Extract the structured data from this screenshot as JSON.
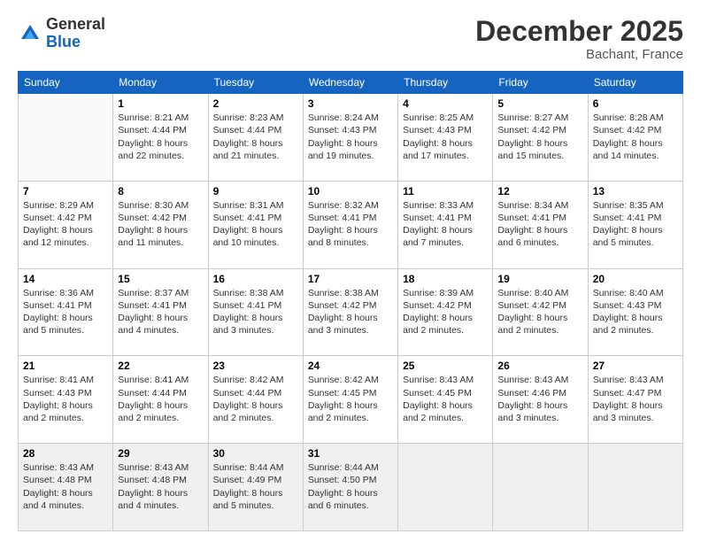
{
  "logo": {
    "general": "General",
    "blue": "Blue"
  },
  "header": {
    "month": "December 2025",
    "location": "Bachant, France"
  },
  "weekdays": [
    "Sunday",
    "Monday",
    "Tuesday",
    "Wednesday",
    "Thursday",
    "Friday",
    "Saturday"
  ],
  "weeks": [
    [
      {
        "day": "",
        "sunrise": "",
        "sunset": "",
        "daylight": ""
      },
      {
        "day": "1",
        "sunrise": "Sunrise: 8:21 AM",
        "sunset": "Sunset: 4:44 PM",
        "daylight": "Daylight: 8 hours and 22 minutes."
      },
      {
        "day": "2",
        "sunrise": "Sunrise: 8:23 AM",
        "sunset": "Sunset: 4:44 PM",
        "daylight": "Daylight: 8 hours and 21 minutes."
      },
      {
        "day": "3",
        "sunrise": "Sunrise: 8:24 AM",
        "sunset": "Sunset: 4:43 PM",
        "daylight": "Daylight: 8 hours and 19 minutes."
      },
      {
        "day": "4",
        "sunrise": "Sunrise: 8:25 AM",
        "sunset": "Sunset: 4:43 PM",
        "daylight": "Daylight: 8 hours and 17 minutes."
      },
      {
        "day": "5",
        "sunrise": "Sunrise: 8:27 AM",
        "sunset": "Sunset: 4:42 PM",
        "daylight": "Daylight: 8 hours and 15 minutes."
      },
      {
        "day": "6",
        "sunrise": "Sunrise: 8:28 AM",
        "sunset": "Sunset: 4:42 PM",
        "daylight": "Daylight: 8 hours and 14 minutes."
      }
    ],
    [
      {
        "day": "7",
        "sunrise": "Sunrise: 8:29 AM",
        "sunset": "Sunset: 4:42 PM",
        "daylight": "Daylight: 8 hours and 12 minutes."
      },
      {
        "day": "8",
        "sunrise": "Sunrise: 8:30 AM",
        "sunset": "Sunset: 4:42 PM",
        "daylight": "Daylight: 8 hours and 11 minutes."
      },
      {
        "day": "9",
        "sunrise": "Sunrise: 8:31 AM",
        "sunset": "Sunset: 4:41 PM",
        "daylight": "Daylight: 8 hours and 10 minutes."
      },
      {
        "day": "10",
        "sunrise": "Sunrise: 8:32 AM",
        "sunset": "Sunset: 4:41 PM",
        "daylight": "Daylight: 8 hours and 8 minutes."
      },
      {
        "day": "11",
        "sunrise": "Sunrise: 8:33 AM",
        "sunset": "Sunset: 4:41 PM",
        "daylight": "Daylight: 8 hours and 7 minutes."
      },
      {
        "day": "12",
        "sunrise": "Sunrise: 8:34 AM",
        "sunset": "Sunset: 4:41 PM",
        "daylight": "Daylight: 8 hours and 6 minutes."
      },
      {
        "day": "13",
        "sunrise": "Sunrise: 8:35 AM",
        "sunset": "Sunset: 4:41 PM",
        "daylight": "Daylight: 8 hours and 5 minutes."
      }
    ],
    [
      {
        "day": "14",
        "sunrise": "Sunrise: 8:36 AM",
        "sunset": "Sunset: 4:41 PM",
        "daylight": "Daylight: 8 hours and 5 minutes."
      },
      {
        "day": "15",
        "sunrise": "Sunrise: 8:37 AM",
        "sunset": "Sunset: 4:41 PM",
        "daylight": "Daylight: 8 hours and 4 minutes."
      },
      {
        "day": "16",
        "sunrise": "Sunrise: 8:38 AM",
        "sunset": "Sunset: 4:41 PM",
        "daylight": "Daylight: 8 hours and 3 minutes."
      },
      {
        "day": "17",
        "sunrise": "Sunrise: 8:38 AM",
        "sunset": "Sunset: 4:42 PM",
        "daylight": "Daylight: 8 hours and 3 minutes."
      },
      {
        "day": "18",
        "sunrise": "Sunrise: 8:39 AM",
        "sunset": "Sunset: 4:42 PM",
        "daylight": "Daylight: 8 hours and 2 minutes."
      },
      {
        "day": "19",
        "sunrise": "Sunrise: 8:40 AM",
        "sunset": "Sunset: 4:42 PM",
        "daylight": "Daylight: 8 hours and 2 minutes."
      },
      {
        "day": "20",
        "sunrise": "Sunrise: 8:40 AM",
        "sunset": "Sunset: 4:43 PM",
        "daylight": "Daylight: 8 hours and 2 minutes."
      }
    ],
    [
      {
        "day": "21",
        "sunrise": "Sunrise: 8:41 AM",
        "sunset": "Sunset: 4:43 PM",
        "daylight": "Daylight: 8 hours and 2 minutes."
      },
      {
        "day": "22",
        "sunrise": "Sunrise: 8:41 AM",
        "sunset": "Sunset: 4:44 PM",
        "daylight": "Daylight: 8 hours and 2 minutes."
      },
      {
        "day": "23",
        "sunrise": "Sunrise: 8:42 AM",
        "sunset": "Sunset: 4:44 PM",
        "daylight": "Daylight: 8 hours and 2 minutes."
      },
      {
        "day": "24",
        "sunrise": "Sunrise: 8:42 AM",
        "sunset": "Sunset: 4:45 PM",
        "daylight": "Daylight: 8 hours and 2 minutes."
      },
      {
        "day": "25",
        "sunrise": "Sunrise: 8:43 AM",
        "sunset": "Sunset: 4:45 PM",
        "daylight": "Daylight: 8 hours and 2 minutes."
      },
      {
        "day": "26",
        "sunrise": "Sunrise: 8:43 AM",
        "sunset": "Sunset: 4:46 PM",
        "daylight": "Daylight: 8 hours and 3 minutes."
      },
      {
        "day": "27",
        "sunrise": "Sunrise: 8:43 AM",
        "sunset": "Sunset: 4:47 PM",
        "daylight": "Daylight: 8 hours and 3 minutes."
      }
    ],
    [
      {
        "day": "28",
        "sunrise": "Sunrise: 8:43 AM",
        "sunset": "Sunset: 4:48 PM",
        "daylight": "Daylight: 8 hours and 4 minutes."
      },
      {
        "day": "29",
        "sunrise": "Sunrise: 8:43 AM",
        "sunset": "Sunset: 4:48 PM",
        "daylight": "Daylight: 8 hours and 4 minutes."
      },
      {
        "day": "30",
        "sunrise": "Sunrise: 8:44 AM",
        "sunset": "Sunset: 4:49 PM",
        "daylight": "Daylight: 8 hours and 5 minutes."
      },
      {
        "day": "31",
        "sunrise": "Sunrise: 8:44 AM",
        "sunset": "Sunset: 4:50 PM",
        "daylight": "Daylight: 8 hours and 6 minutes."
      },
      {
        "day": "",
        "sunrise": "",
        "sunset": "",
        "daylight": ""
      },
      {
        "day": "",
        "sunrise": "",
        "sunset": "",
        "daylight": ""
      },
      {
        "day": "",
        "sunrise": "",
        "sunset": "",
        "daylight": ""
      }
    ]
  ]
}
